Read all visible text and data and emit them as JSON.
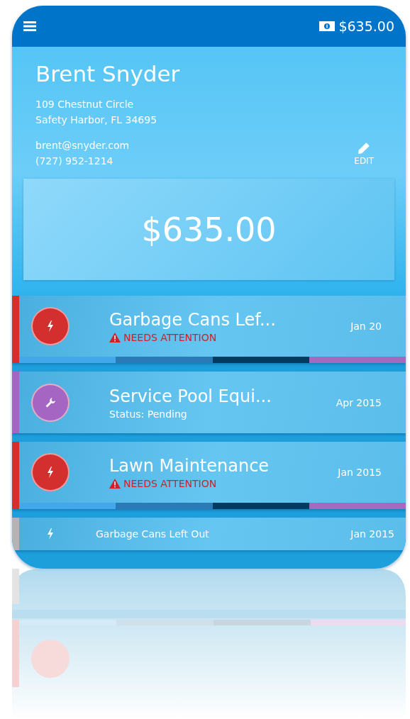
{
  "top_bar": {
    "balance": "$635.00"
  },
  "customer": {
    "name": "Brent Snyder",
    "address_lines": [
      "109 Chestnut Circle",
      "Safety Harbor, FL 34695"
    ],
    "email": "brent@snyder.com",
    "phone": "(727) 952-1214",
    "edit_label": "EDIT"
  },
  "balance_card": {
    "amount": "$635.00"
  },
  "jobs": [
    {
      "kind": "alert",
      "color": "#d32f2f",
      "title": "Garbage Cans Lef...",
      "status": "NEEDS ATTENTION",
      "date": "Jan 20",
      "progress_bar": true
    },
    {
      "kind": "pending",
      "color": "#a466c2",
      "title": "Service Pool Equi...",
      "status": "Status: Pending",
      "date": "Apr 2015",
      "progress_bar": false
    },
    {
      "kind": "alert",
      "color": "#d32f2f",
      "title": "Lawn Maintenance",
      "status": "NEEDS ATTENTION",
      "date": "Jan 2015",
      "progress_bar": true
    },
    {
      "kind": "compact",
      "color": "#b4b4b4",
      "title": "Garbage Cans Left Out",
      "date": "Jan 2015"
    }
  ]
}
